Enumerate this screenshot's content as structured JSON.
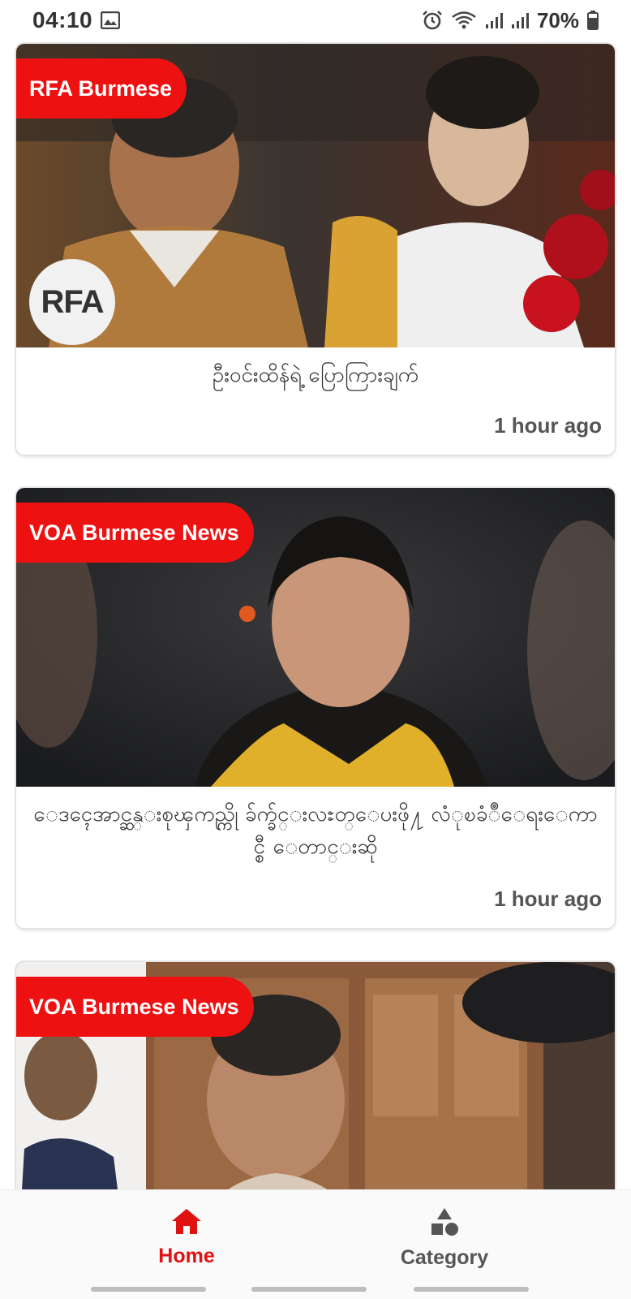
{
  "status_bar": {
    "time": "04:10",
    "battery_percent": "70%",
    "icons": [
      "gallery-icon",
      "alarm-icon",
      "wifi-icon",
      "signal-icon",
      "signal-icon",
      "battery-icon"
    ]
  },
  "feed": {
    "articles": [
      {
        "source": "RFA Burmese",
        "title": "ဦးဝင်းထိန်ရဲ့ ပြောကြားချက်",
        "time": "1 hour ago",
        "logo": "RFA"
      },
      {
        "source": "VOA Burmese News",
        "title": "ေဒၚေအာင္ဆန္းစုၾကည္ကို ခ်က္ခ်င္းလႊတ္ေပးဖို႔ လံုၿခံဳေရးေကာင္စီ ေတာင္းဆို",
        "time": "1 hour ago"
      },
      {
        "source": "VOA Burmese News"
      }
    ]
  },
  "bottom_nav": {
    "items": [
      {
        "label": "Home",
        "icon": "home-icon",
        "active": true
      },
      {
        "label": "Category",
        "icon": "category-icon",
        "active": false
      }
    ]
  },
  "colors": {
    "accent": "#ee1111",
    "active_nav": "#e01111",
    "inactive_nav": "#555555"
  }
}
